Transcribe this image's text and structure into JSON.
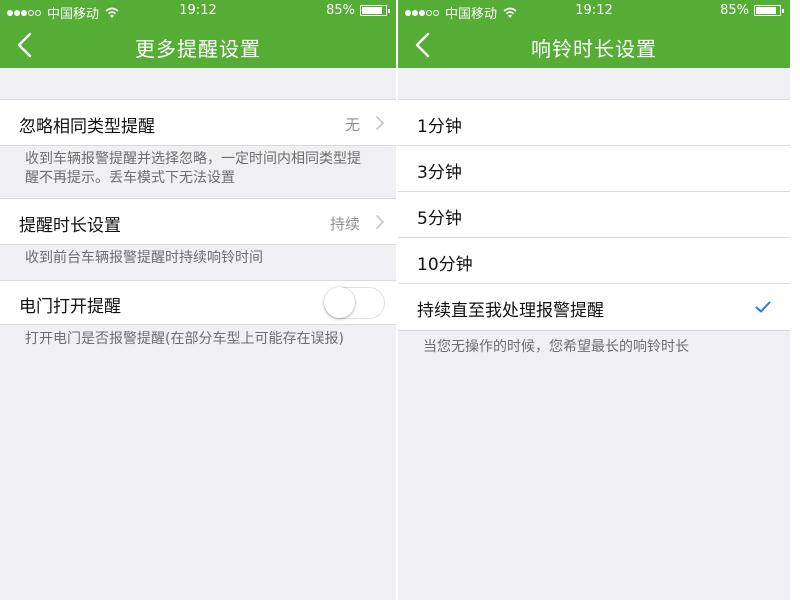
{
  "status_bar": {
    "signal_dots": [
      "on",
      "on",
      "on",
      "off",
      "off"
    ],
    "carrier": "中国移动",
    "time": "19:12",
    "battery_percent": "85%",
    "battery_level": 0.85
  },
  "left_screen": {
    "nav_title": "更多提醒设置",
    "settings": [
      {
        "label": "忽略相同类型提醒",
        "value": "无",
        "description": "收到车辆报警提醒并选择忽略，一定时间内相同类型提醒不再提示。丢车模式下无法设置"
      },
      {
        "label": "提醒时长设置",
        "value": "持续",
        "description": "收到前台车辆报警提醒时持续响铃时间"
      },
      {
        "label": "电门打开提醒",
        "toggle_on": false,
        "description": "打开电门是否报警提醒(在部分车型上可能存在误报)"
      }
    ]
  },
  "right_screen": {
    "nav_title": "响铃时长设置",
    "options": [
      {
        "label": "1分钟",
        "selected": false
      },
      {
        "label": "3分钟",
        "selected": false
      },
      {
        "label": "5分钟",
        "selected": false
      },
      {
        "label": "10分钟",
        "selected": false
      },
      {
        "label": "持续直至我处理报警提醒",
        "selected": true
      }
    ],
    "footer_note": "当您无操作的时候，您希望最长的响铃时长"
  },
  "colors": {
    "nav_green": "#55ad35",
    "background": "#efeff4",
    "checkmark_blue": "#1a7ee6"
  },
  "icons": [
    "back-icon",
    "chevron-right-icon",
    "checkmark-icon",
    "wifi-icon",
    "battery-icon",
    "signal-icon"
  ]
}
